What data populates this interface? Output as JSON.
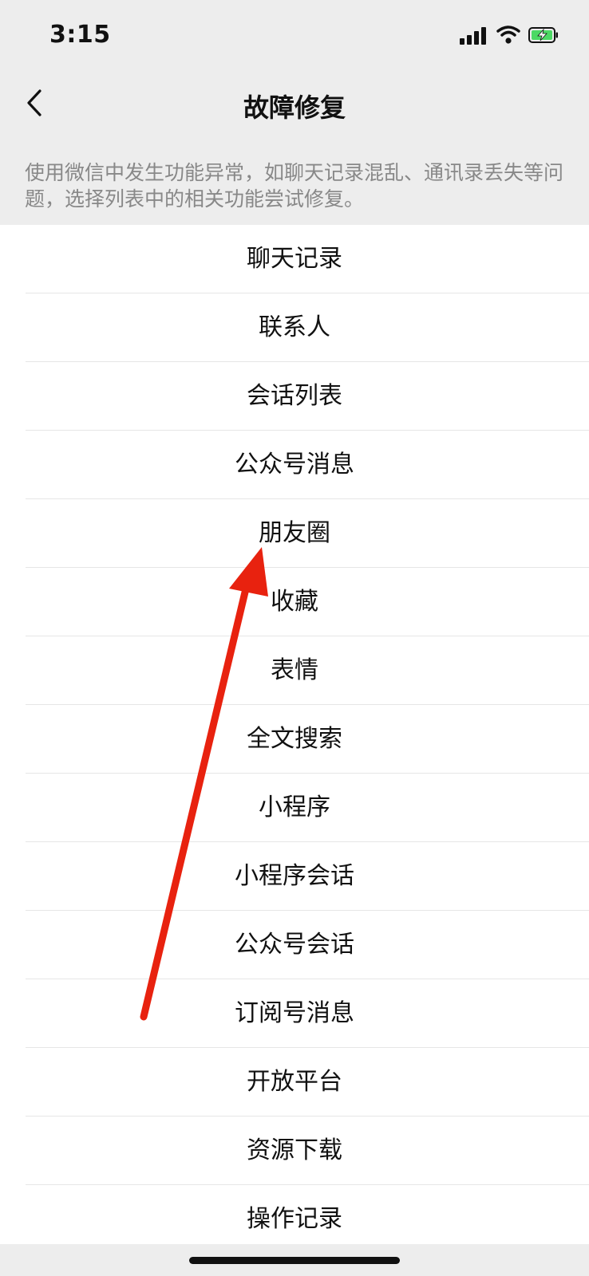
{
  "status": {
    "time": "3:15"
  },
  "nav": {
    "title": "故障修复"
  },
  "description": "使用微信中发生功能异常，如聊天记录混乱、通讯录丢失等问题，选择列表中的相关功能尝试修复。",
  "items": [
    {
      "label": "聊天记录"
    },
    {
      "label": "联系人"
    },
    {
      "label": "会话列表"
    },
    {
      "label": "公众号消息"
    },
    {
      "label": "朋友圈"
    },
    {
      "label": "收藏"
    },
    {
      "label": "表情"
    },
    {
      "label": "全文搜索"
    },
    {
      "label": "小程序"
    },
    {
      "label": "小程序会话"
    },
    {
      "label": "公众号会话"
    },
    {
      "label": "订阅号消息"
    },
    {
      "label": "开放平台"
    },
    {
      "label": "资源下载"
    },
    {
      "label": "操作记录"
    }
  ],
  "colors": {
    "background": "#ededed",
    "arrow": "#e8220f",
    "battery": "#4cd964",
    "description_text": "#888888"
  },
  "icons": [
    "signal-icon",
    "wifi-icon",
    "battery-icon",
    "back-chevron-icon"
  ]
}
